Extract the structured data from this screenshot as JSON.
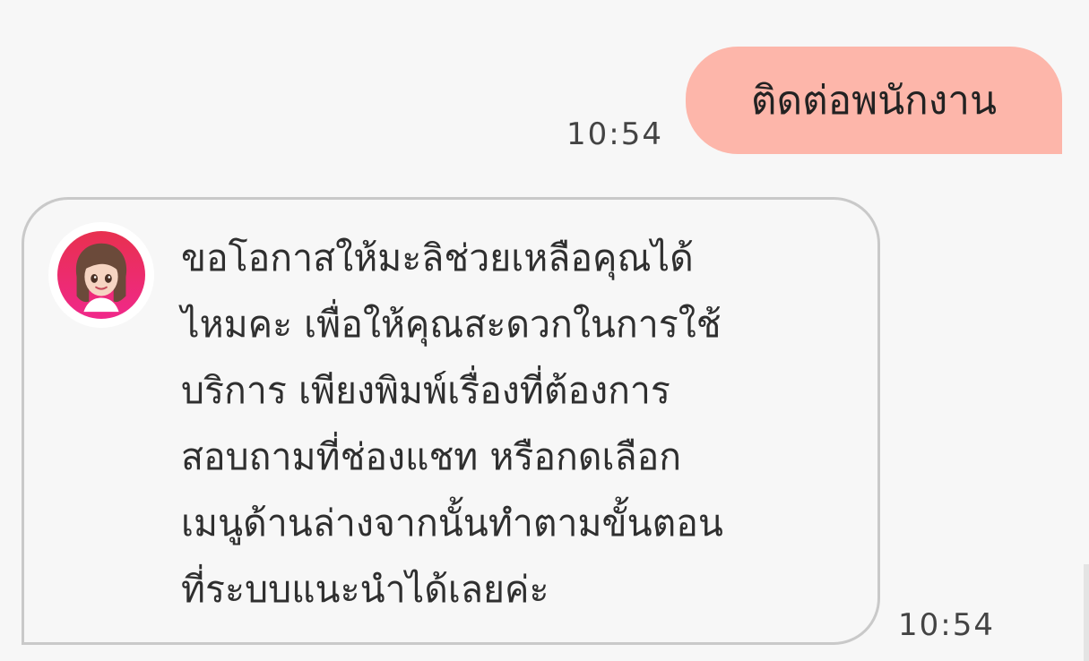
{
  "messages": {
    "outgoing": {
      "text": "ติดต่อพนักงาน",
      "time": "10:54",
      "bubble_color": "#fdb6aa"
    },
    "incoming": {
      "lines": [
        "ขอโอกาสให้มะลิช่วยเหลือคุณได้",
        "ไหมคะ เพื่อให้คุณสะดวกในการใช้",
        "บริการ เพียงพิมพ์เรื่องที่ต้องการ",
        "สอบถามที่ช่องแชท หรือกดเลือก",
        "เมนูด้านล่างจากนั้นทำตามขั้นตอน",
        "ที่ระบบแนะนำได้เลยค่ะ"
      ],
      "time": "10:54",
      "avatar_icon": "bot-avatar-icon",
      "border_color": "#c9c9c9"
    }
  }
}
